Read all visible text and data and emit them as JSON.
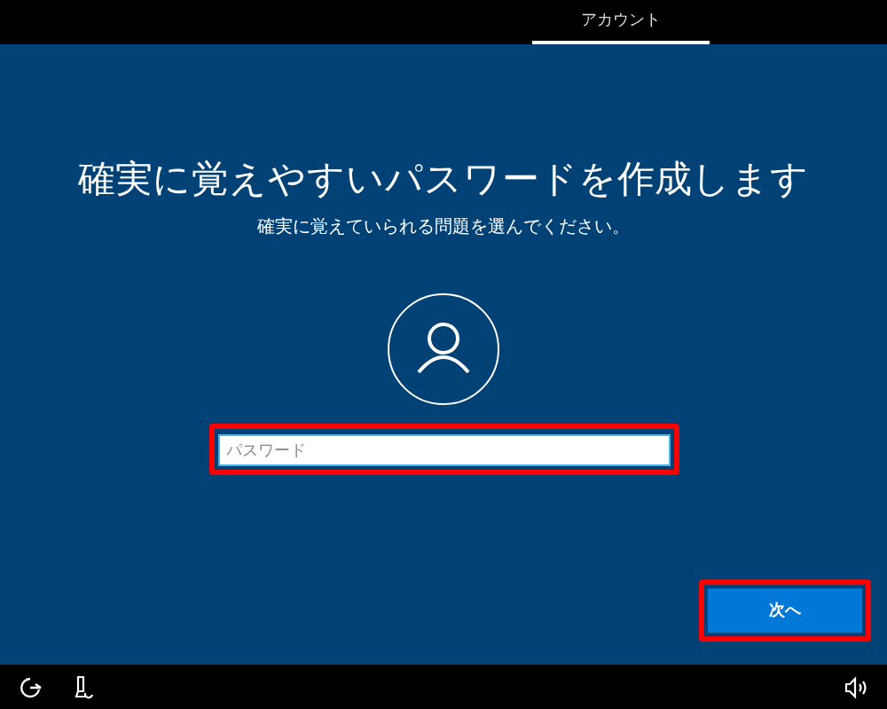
{
  "top_bar": {
    "tabs": [
      {
        "label": "アカウント",
        "selected": true
      }
    ]
  },
  "title": "確実に覚えやすいパスワードを作成します",
  "subtitle": "確実に覚えていられる問題を選んでください。",
  "password_field": {
    "placeholder": "パスワード",
    "highlighted": true
  },
  "next_button": {
    "label": "次へ",
    "highlighted": true
  }
}
